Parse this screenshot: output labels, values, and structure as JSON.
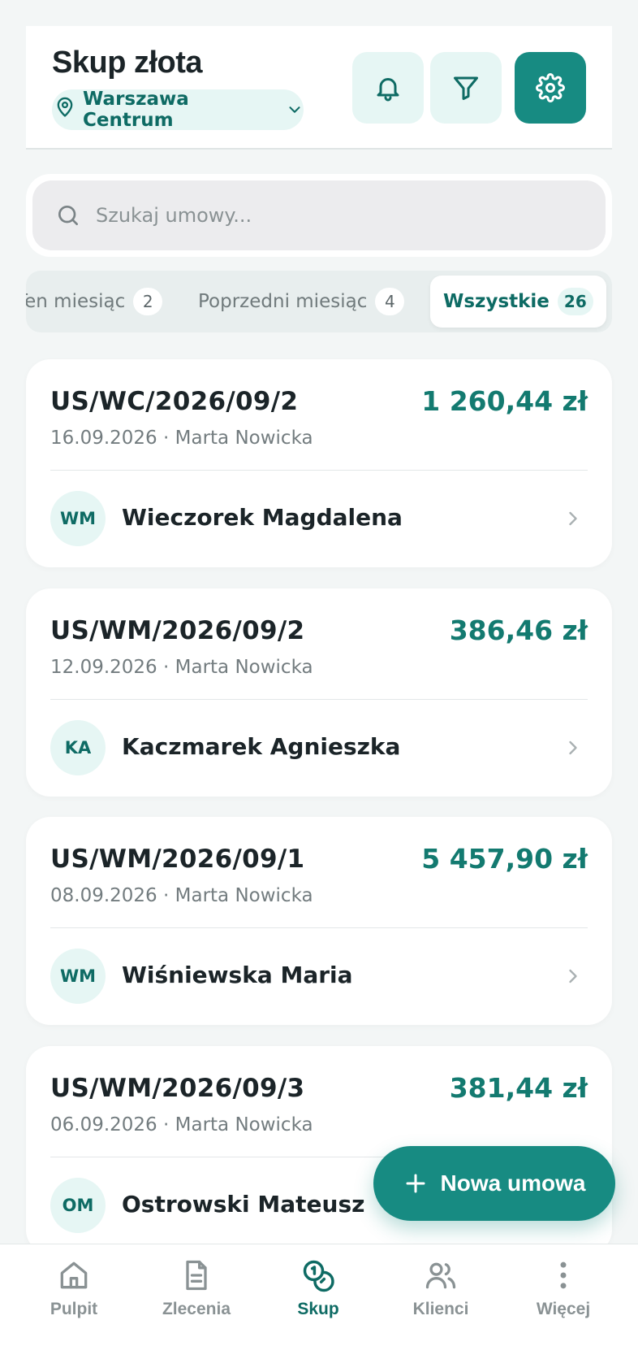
{
  "header": {
    "title": "Skup złota",
    "location": "Warszawa Centrum"
  },
  "search": {
    "placeholder": "Szukaj umowy..."
  },
  "tabs": [
    {
      "label": "Ten miesiąc",
      "count": "2"
    },
    {
      "label": "Poprzedni miesiąc",
      "count": "4"
    },
    {
      "label": "Wszystkie",
      "count": "26"
    }
  ],
  "contracts": [
    {
      "number": "US/WC/2026/09/2",
      "amount": "1 260,44 zł",
      "date": "16.09.2026",
      "employee": "Marta Nowicka",
      "initials": "WM",
      "client": "Wieczorek Magdalena"
    },
    {
      "number": "US/WM/2026/09/2",
      "amount": "386,46 zł",
      "date": "12.09.2026",
      "employee": "Marta Nowicka",
      "initials": "KA",
      "client": "Kaczmarek Agnieszka"
    },
    {
      "number": "US/WM/2026/09/1",
      "amount": "5 457,90 zł",
      "date": "08.09.2026",
      "employee": "Marta Nowicka",
      "initials": "WM",
      "client": "Wiśniewska Maria"
    },
    {
      "number": "US/WM/2026/09/3",
      "amount": "381,44 zł",
      "date": "06.09.2026",
      "employee": "Marta Nowicka",
      "initials": "OM",
      "client": "Ostrowski Mateusz"
    }
  ],
  "meta_separator": " · ",
  "fab": {
    "label": "Nowa umowa"
  },
  "nav": [
    {
      "label": "Pulpit",
      "icon": "home-icon"
    },
    {
      "label": "Zlecenia",
      "icon": "document-icon"
    },
    {
      "label": "Skup",
      "icon": "coins-icon"
    },
    {
      "label": "Klienci",
      "icon": "users-icon"
    },
    {
      "label": "Więcej",
      "icon": "more-vertical-icon"
    }
  ],
  "colors": {
    "accent": "#178b82",
    "accent_dark": "#0e6b64",
    "accent_soft": "#e6f6f4",
    "background": "#f3f6f6"
  }
}
